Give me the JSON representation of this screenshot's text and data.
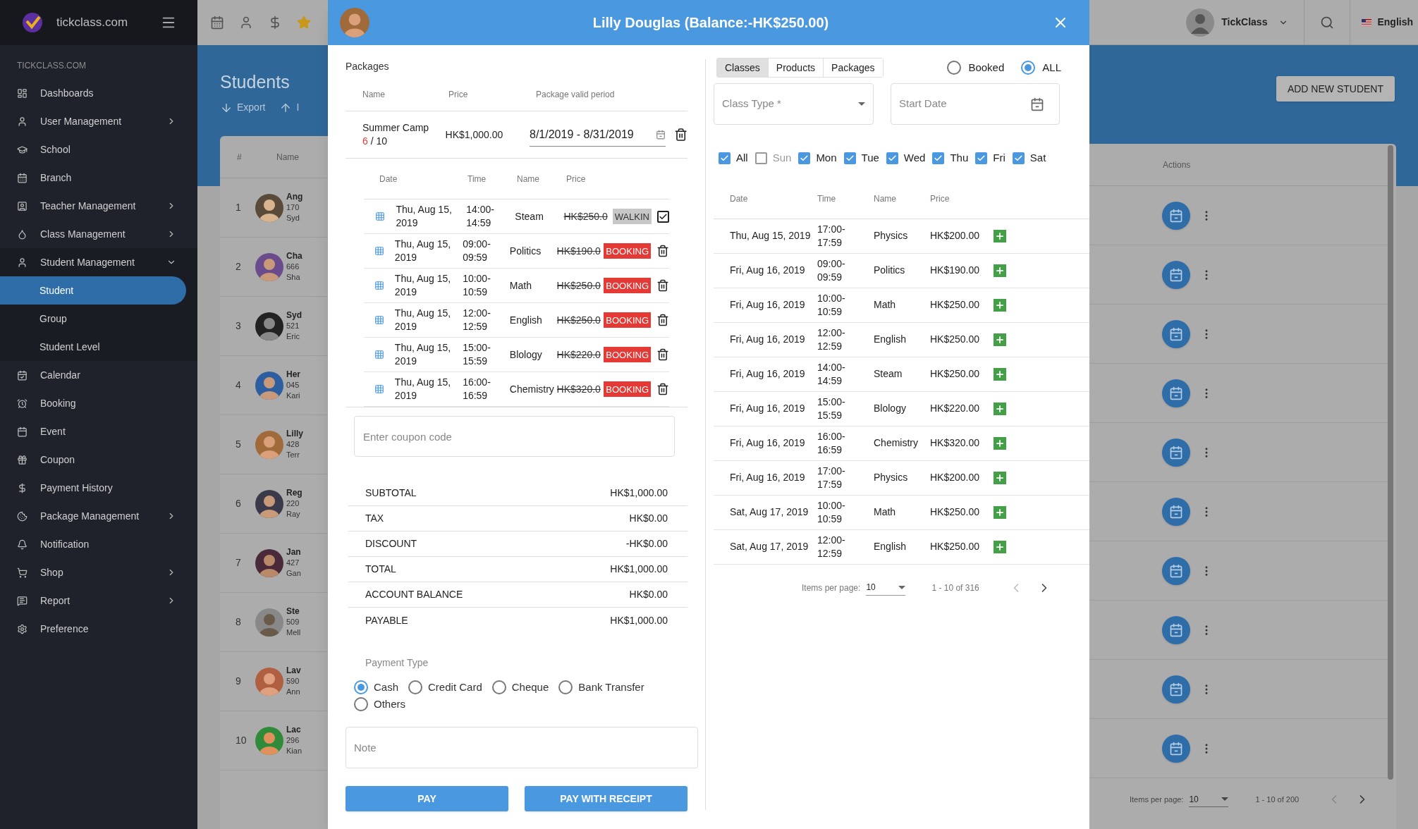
{
  "brand": {
    "name": "tickclass.com"
  },
  "sidebar": {
    "section": "TICKCLASS.COM",
    "items": [
      {
        "label": "Dashboards",
        "kind": "link",
        "selected": false
      },
      {
        "label": "User Management",
        "kind": "group",
        "expanded": false,
        "selected": false
      },
      {
        "label": "School",
        "kind": "link",
        "selected": false
      },
      {
        "label": "Branch",
        "kind": "link",
        "selected": false
      },
      {
        "label": "Teacher Management",
        "kind": "group",
        "expanded": false,
        "selected": false
      },
      {
        "label": "Class Management",
        "kind": "group",
        "expanded": false,
        "selected": false
      },
      {
        "label": "Student Management",
        "kind": "group",
        "expanded": true,
        "selected": false,
        "children": [
          {
            "label": "Student",
            "selected": true
          },
          {
            "label": "Group",
            "selected": false
          },
          {
            "label": "Student Level",
            "selected": false
          }
        ]
      },
      {
        "label": "Calendar",
        "kind": "link",
        "selected": false
      },
      {
        "label": "Booking",
        "kind": "link",
        "selected": false
      },
      {
        "label": "Event",
        "kind": "link",
        "selected": false
      },
      {
        "label": "Coupon",
        "kind": "link",
        "selected": false
      },
      {
        "label": "Payment History",
        "kind": "link",
        "selected": false
      },
      {
        "label": "Package Management",
        "kind": "group",
        "expanded": false,
        "selected": false
      },
      {
        "label": "Notification",
        "kind": "link",
        "selected": false
      },
      {
        "label": "Shop",
        "kind": "group",
        "expanded": false,
        "selected": false
      },
      {
        "label": "Report",
        "kind": "group",
        "expanded": false,
        "selected": false
      },
      {
        "label": "Preference",
        "kind": "link",
        "selected": false
      }
    ]
  },
  "topbar": {
    "user": "TickClass",
    "language": "English"
  },
  "page": {
    "title": "Students",
    "actions": [
      "Export",
      "I"
    ],
    "add_button": "ADD NEW STUDENT",
    "table": {
      "columns": [
        "#",
        "Name"
      ],
      "actions_column": "Actions",
      "rows": [
        {
          "index": "1",
          "name": "Ang",
          "phone": "170",
          "extra": "Syd"
        },
        {
          "index": "2",
          "name": "Cha",
          "phone": "666",
          "extra": "Sha"
        },
        {
          "index": "3",
          "name": "Syd",
          "phone": "521",
          "extra": "Eric"
        },
        {
          "index": "4",
          "name": "Her",
          "phone": "045",
          "extra": "Kari"
        },
        {
          "index": "5",
          "name": "Lilly",
          "phone": "428",
          "extra": "Terr"
        },
        {
          "index": "6",
          "name": "Reg",
          "phone": "220",
          "extra": "Ray"
        },
        {
          "index": "7",
          "name": "Jan",
          "phone": "427",
          "extra": "Gan"
        },
        {
          "index": "8",
          "name": "Ste",
          "phone": "509",
          "extra": "Mell"
        },
        {
          "index": "9",
          "name": "Lav",
          "phone": "590",
          "extra": "Ann"
        },
        {
          "index": "10",
          "name": "Lac",
          "phone": "296",
          "extra": "Kian"
        }
      ]
    },
    "pagination": {
      "label": "Items per page:",
      "per_page": "10",
      "range": "1 - 10 of 200"
    }
  },
  "dialog": {
    "title": "Lilly Douglas (Balance:-HK$250.00)",
    "packages": {
      "heading": "Packages",
      "columns": [
        "Name",
        "Price",
        "Package valid period"
      ],
      "rows": [
        {
          "name": "Summer Camp",
          "used": "6",
          "total": "/ 10",
          "price": "HK$1,000.00",
          "period": "8/1/2019 - 8/31/2019"
        }
      ]
    },
    "bookings": {
      "columns": [
        "Date",
        "Time",
        "Name",
        "Price"
      ],
      "rows": [
        {
          "date": "Thu, Aug 15, 2019",
          "time": "14:00-14:59",
          "name": "Steam",
          "price": "HK$250.0",
          "status": "WALKIN",
          "kind": "walkin",
          "checked": true
        },
        {
          "date": "Thu, Aug 15, 2019",
          "time": "09:00-09:59",
          "name": "Politics",
          "price": "HK$190.0",
          "status": "BOOKING",
          "kind": "booking"
        },
        {
          "date": "Thu, Aug 15, 2019",
          "time": "10:00-10:59",
          "name": "Math",
          "price": "HK$250.0",
          "status": "BOOKING",
          "kind": "booking"
        },
        {
          "date": "Thu, Aug 15, 2019",
          "time": "12:00-12:59",
          "name": "English",
          "price": "HK$250.0",
          "status": "BOOKING",
          "kind": "booking"
        },
        {
          "date": "Thu, Aug 15, 2019",
          "time": "15:00-15:59",
          "name": "Blology",
          "price": "HK$220.0",
          "status": "BOOKING",
          "kind": "booking"
        },
        {
          "date": "Thu, Aug 15, 2019",
          "time": "16:00-16:59",
          "name": "Chemistry",
          "price": "HK$320.0",
          "status": "BOOKING",
          "kind": "booking"
        }
      ]
    },
    "coupon": {
      "placeholder": "Enter coupon code"
    },
    "summary": [
      {
        "label": "SUBTOTAL",
        "value": "HK$1,000.00"
      },
      {
        "label": "TAX",
        "value": "HK$0.00"
      },
      {
        "label": "DISCOUNT",
        "value": "-HK$0.00"
      },
      {
        "label": "TOTAL",
        "value": "HK$1,000.00"
      },
      {
        "label": "ACCOUNT BALANCE",
        "value": "HK$0.00"
      },
      {
        "label": "PAYABLE",
        "value": "HK$1,000.00"
      }
    ],
    "payment": {
      "label": "Payment Type",
      "options": [
        {
          "label": "Cash",
          "selected": true
        },
        {
          "label": "Credit Card",
          "selected": false
        },
        {
          "label": "Cheque",
          "selected": false
        },
        {
          "label": "Bank Transfer",
          "selected": false
        },
        {
          "label": "Others",
          "selected": false
        }
      ]
    },
    "note": {
      "placeholder": "Note"
    },
    "buttons": [
      "PAY",
      "PAY WITH RECEIPT"
    ],
    "tabs": [
      {
        "label": "Classes",
        "selected": true
      },
      {
        "label": "Products",
        "selected": false
      },
      {
        "label": "Packages",
        "selected": false
      }
    ],
    "filter": [
      {
        "label": "Booked",
        "selected": false
      },
      {
        "label": "ALL",
        "selected": true
      }
    ],
    "class_type": {
      "placeholder": "Class Type *"
    },
    "start_date": {
      "placeholder": "Start Date"
    },
    "days": [
      {
        "label": "All",
        "checked": true
      },
      {
        "label": "Sun",
        "checked": false
      },
      {
        "label": "Mon",
        "checked": true
      },
      {
        "label": "Tue",
        "checked": true
      },
      {
        "label": "Wed",
        "checked": true
      },
      {
        "label": "Thu",
        "checked": true
      },
      {
        "label": "Fri",
        "checked": true
      },
      {
        "label": "Sat",
        "checked": true
      }
    ],
    "classes": {
      "columns": [
        "Date",
        "Time",
        "Name",
        "Price"
      ],
      "rows": [
        {
          "date": "Thu, Aug 15, 2019",
          "time": "17:00-17:59",
          "name": "Physics",
          "price": "HK$200.00"
        },
        {
          "date": "Fri, Aug 16, 2019",
          "time": "09:00-09:59",
          "name": "Politics",
          "price": "HK$190.00"
        },
        {
          "date": "Fri, Aug 16, 2019",
          "time": "10:00-10:59",
          "name": "Math",
          "price": "HK$250.00"
        },
        {
          "date": "Fri, Aug 16, 2019",
          "time": "12:00-12:59",
          "name": "English",
          "price": "HK$250.00"
        },
        {
          "date": "Fri, Aug 16, 2019",
          "time": "14:00-14:59",
          "name": "Steam",
          "price": "HK$250.00"
        },
        {
          "date": "Fri, Aug 16, 2019",
          "time": "15:00-15:59",
          "name": "Blology",
          "price": "HK$220.00"
        },
        {
          "date": "Fri, Aug 16, 2019",
          "time": "16:00-16:59",
          "name": "Chemistry",
          "price": "HK$320.00"
        },
        {
          "date": "Fri, Aug 16, 2019",
          "time": "17:00-17:59",
          "name": "Physics",
          "price": "HK$200.00"
        },
        {
          "date": "Sat, Aug 17, 2019",
          "time": "10:00-10:59",
          "name": "Math",
          "price": "HK$250.00"
        },
        {
          "date": "Sat, Aug 17, 2019",
          "time": "12:00-12:59",
          "name": "English",
          "price": "HK$250.00"
        }
      ]
    },
    "pagination": {
      "label": "Items per page:",
      "per_page": "10",
      "range": "1 - 10 of 316"
    }
  }
}
